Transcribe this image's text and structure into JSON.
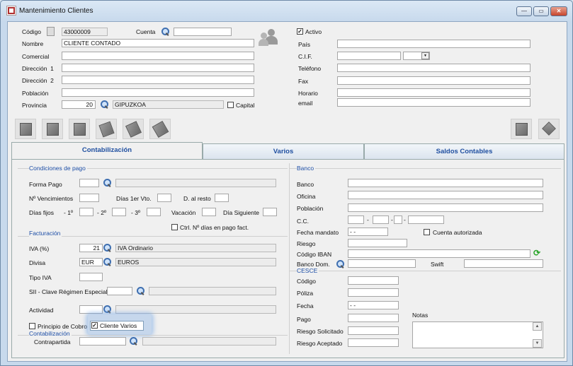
{
  "window": {
    "title": "Mantenimiento Clientes",
    "buttons": {
      "minimize": "—",
      "maximize": "▭",
      "close": "✕"
    }
  },
  "header": {
    "codigo": {
      "label": "Código",
      "value": "43000009"
    },
    "cuenta": {
      "label": "Cuenta",
      "value": ""
    },
    "nombre": {
      "label": "Nombre",
      "value": "CLIENTE CONTADO"
    },
    "comercial": {
      "label": "Comercial",
      "value": ""
    },
    "direccion1": {
      "label": "Dirección",
      "num": "1",
      "value": ""
    },
    "direccion2": {
      "label": "Dirección",
      "num": "2",
      "value": ""
    },
    "poblacion": {
      "label": "Población",
      "value": ""
    },
    "provincia": {
      "label": "Provincia",
      "code": "20",
      "name": "GIPUZKOA"
    },
    "capital": {
      "label": "Capital",
      "checked": false
    },
    "activo": {
      "label": "Activo",
      "checked": true
    },
    "pais": {
      "label": "País",
      "value": ""
    },
    "cif": {
      "label": "C.I.F.",
      "value": ""
    },
    "telefono": {
      "label": "Teléfono",
      "value": ""
    },
    "fax": {
      "label": "Fax",
      "value": ""
    },
    "horario": {
      "label": "Horario",
      "value": ""
    },
    "email": {
      "label": "email",
      "value": ""
    }
  },
  "tabs": [
    {
      "label": "Contabilización",
      "active": true
    },
    {
      "label": "Varios",
      "active": false
    },
    {
      "label": "Saldos Contables",
      "active": false
    }
  ],
  "condiciones": {
    "title": "Condiciones de pago",
    "forma_pago": "Forma Pago",
    "n_vencimientos": "Nº Vencimientos",
    "dias_1er": "Días 1er Vto.",
    "d_resto": "D. al resto",
    "dias_fijos": "Días fijos",
    "d1": "- 1º",
    "d2": "- 2º",
    "d3": "- 3º",
    "vacacion": "Vacación",
    "dia_siguiente": "Día Siguiente",
    "ctrl_dias": "Ctrl. Nº días en pago fact."
  },
  "facturacion": {
    "title": "Facturación",
    "iva_label": "IVA (%)",
    "iva_value": "21",
    "iva_desc": "IVA Ordinario",
    "divisa_label": "Divisa",
    "divisa_code": "EUR",
    "divisa_desc": "EUROS",
    "tipo_iva": "Tipo IVA",
    "sii_label": "SII - Clave Régimen Especial",
    "actividad": "Actividad",
    "principio_cobro": "Principio de Cobro",
    "cliente_varios": "Cliente Varios",
    "cliente_varios_checked": true
  },
  "contabilizacion": {
    "title": "Contabilización",
    "contrapartida": "Contrapartida"
  },
  "banco": {
    "title": "Banco",
    "banco": "Banco",
    "oficina": "Oficina",
    "poblacion": "Población",
    "cc": "C.C.",
    "fecha_mandato": "Fecha mandato",
    "fecha_mandato_value": "-  -",
    "cuenta_autorizada": "Cuenta autorizada",
    "riesgo": "Riesgo",
    "codigo_iban": "Código IBAN",
    "banco_dom": "Banco Dom.",
    "swift": "Swift",
    "dash": "-"
  },
  "cesce": {
    "title": "CESCE",
    "codigo": "Código",
    "poliza": "Póliza",
    "fecha": "Fecha",
    "fecha_value": "-  -",
    "pago": "Pago",
    "riesgo_solicitado": "Riesgo Solicitado",
    "riesgo_aceptado": "Riesgo Aceptado",
    "notas": "Notas"
  },
  "icons": {
    "up": "▲",
    "down": "▼",
    "dropdown": "▼",
    "refresh": "⟳"
  }
}
